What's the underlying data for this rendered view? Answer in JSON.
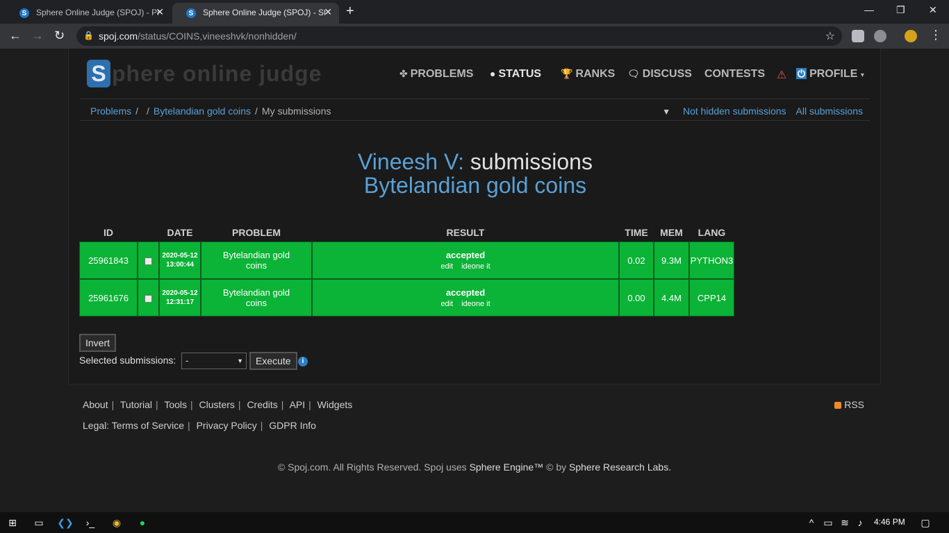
{
  "browser": {
    "tabs": [
      {
        "title": "Sphere Online Judge (SPOJ) - Pro",
        "favicon": "S"
      },
      {
        "title": "Sphere Online Judge (SPOJ) - Sta",
        "favicon": "S"
      }
    ],
    "new_tab": "+",
    "url_host": "spoj.com",
    "url_path": "/status/COINS,vineeshvk/nonhidden/"
  },
  "site": {
    "logo_letter": "S",
    "logo_text": "phere online judge",
    "nav": [
      {
        "label": "PROBLEMS",
        "icon": "puzzle-icon"
      },
      {
        "label": "STATUS",
        "icon": "circle-icon"
      },
      {
        "label": "RANKS",
        "icon": "trophy-icon"
      },
      {
        "label": "DISCUSS",
        "icon": "comments-icon"
      },
      {
        "label": "CONTESTS",
        "icon": ""
      },
      {
        "label": "PROFILE",
        "icon": "power-icon"
      }
    ]
  },
  "breadcrumb": {
    "problems": "Problems",
    "problem": "Bytelandian gold coins",
    "current": "My submissions"
  },
  "subnav": {
    "not_hidden": "Not hidden submissions",
    "all": "All submissions"
  },
  "heading": {
    "name": "Vineesh V:",
    "word": "submissions",
    "problem": "Bytelandian gold coins"
  },
  "table": {
    "headers": [
      "ID",
      "",
      "DATE",
      "PROBLEM",
      "RESULT",
      "TIME",
      "MEM",
      "LANG"
    ],
    "rows": [
      {
        "id": "25961843",
        "date": "2020-05-12",
        "time_of_day": "13:00:44",
        "problem": "Bytelandian gold coins",
        "result": "accepted",
        "edit": "edit",
        "ideone": "ideone it",
        "time": "0.02",
        "mem": "9.3M",
        "lang": "PYTHON3"
      },
      {
        "id": "25961676",
        "date": "2020-05-12",
        "time_of_day": "12:31:17",
        "problem": "Bytelandian gold coins",
        "result": "accepted",
        "edit": "edit",
        "ideone": "ideone it",
        "time": "0.00",
        "mem": "4.4M",
        "lang": "CPP14"
      }
    ],
    "accent": "#0bb336"
  },
  "actions": {
    "invert": "Invert",
    "selected_label": "Selected submissions:",
    "selected_value": "-",
    "execute": "Execute"
  },
  "footer": {
    "links": [
      "About",
      "Tutorial",
      "Tools",
      "Clusters",
      "Credits",
      "API",
      "Widgets"
    ],
    "legal_prefix": "Legal:",
    "legal_links": [
      "Terms of Service",
      "Privacy Policy",
      "GDPR Info"
    ],
    "rss": "RSS",
    "copyright_pre": "© Spoj.com. All Rights Reserved. Spoj uses",
    "engine": "Sphere Engine™",
    "copyright_mid": "© by",
    "labs": "Sphere Research Labs."
  },
  "taskbar": {
    "clock": "4:46 PM"
  }
}
